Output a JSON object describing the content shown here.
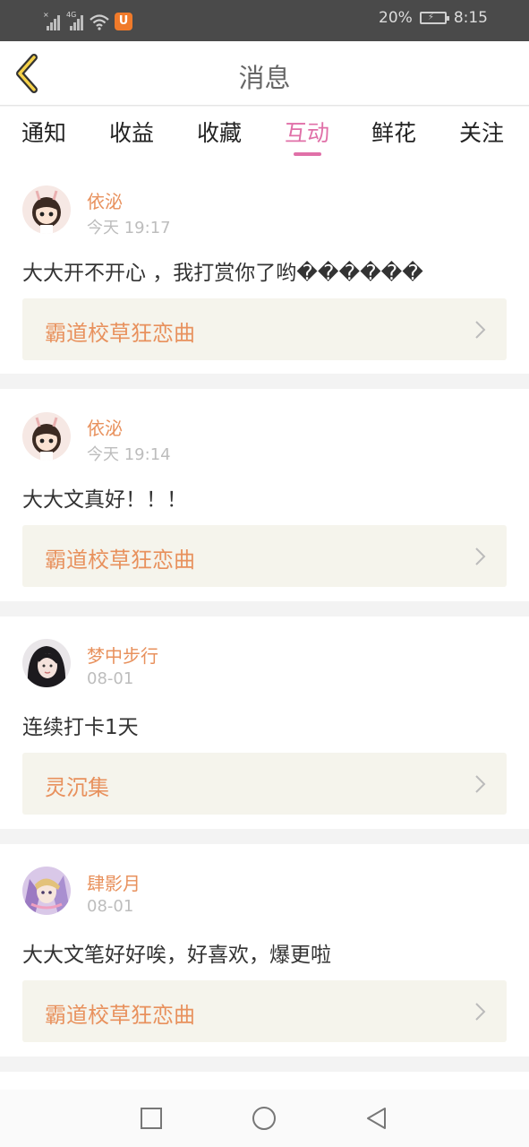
{
  "status_bar": {
    "network_1": "×",
    "network_2": "4G",
    "app_icon_glyph": "U",
    "battery": "20%",
    "time": "8:15"
  },
  "header": {
    "title": "消息"
  },
  "tabs": [
    {
      "label": "通知",
      "active": false
    },
    {
      "label": "收益",
      "active": false
    },
    {
      "label": "收藏",
      "active": false
    },
    {
      "label": "互动",
      "active": true
    },
    {
      "label": "鲜花",
      "active": false
    },
    {
      "label": "关注",
      "active": false
    }
  ],
  "messages": [
    {
      "user": "依泌",
      "time": "今天 19:17",
      "text": "大大开不开心 ，我打赏你了哟������",
      "book": "霸道校草狂恋曲"
    },
    {
      "user": "依泌",
      "time": "今天 19:14",
      "text": "大大文真好！！！",
      "book": "霸道校草狂恋曲"
    },
    {
      "user": "梦中步行",
      "time": "08-01",
      "text": "连续打卡1天",
      "book": "灵沉集"
    },
    {
      "user": "肆影月",
      "time": "08-01",
      "text": "大大文笔好好唉，好喜欢，爆更啦",
      "book": "霸道校草狂恋曲"
    }
  ],
  "colors": {
    "accent": "#e070a8",
    "username": "#e8915d",
    "book_bg": "#f5f4ec",
    "statusbar": "#4a4a4a"
  },
  "icons": {
    "back": "chevron-left-icon",
    "nav": [
      "recent-apps-icon",
      "home-icon",
      "back-triangle-icon"
    ]
  }
}
